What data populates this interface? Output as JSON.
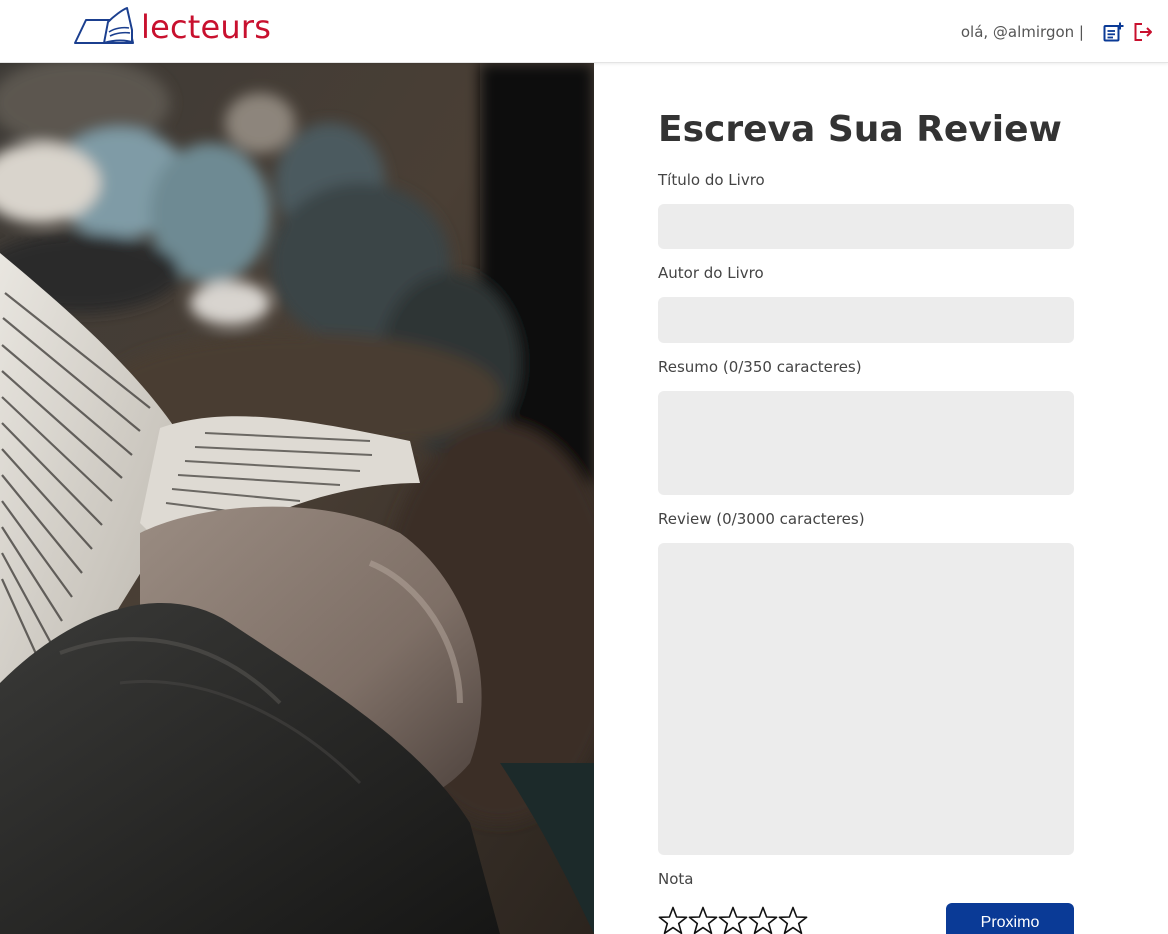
{
  "header": {
    "brand": "lecteurs",
    "greeting": "olá, @almirgon |",
    "new_review_icon": "note-add-icon",
    "logout_icon": "logout-icon"
  },
  "form": {
    "title": "Escreva Sua Review",
    "book_title_label": "Título do Livro",
    "book_title_value": "",
    "author_label": "Autor do Livro",
    "author_value": "",
    "summary_label": "Resumo (0/350 caracteres)",
    "summary_value": "",
    "review_label": "Review (0/3000 caracteres)",
    "review_value": "",
    "rating_label": "Nota",
    "rating_value": 0,
    "rating_max": 5,
    "next_button": "Proximo"
  },
  "colors": {
    "brand_red": "#c8102e",
    "brand_blue": "#0a3a96",
    "field_bg": "#ececec"
  }
}
